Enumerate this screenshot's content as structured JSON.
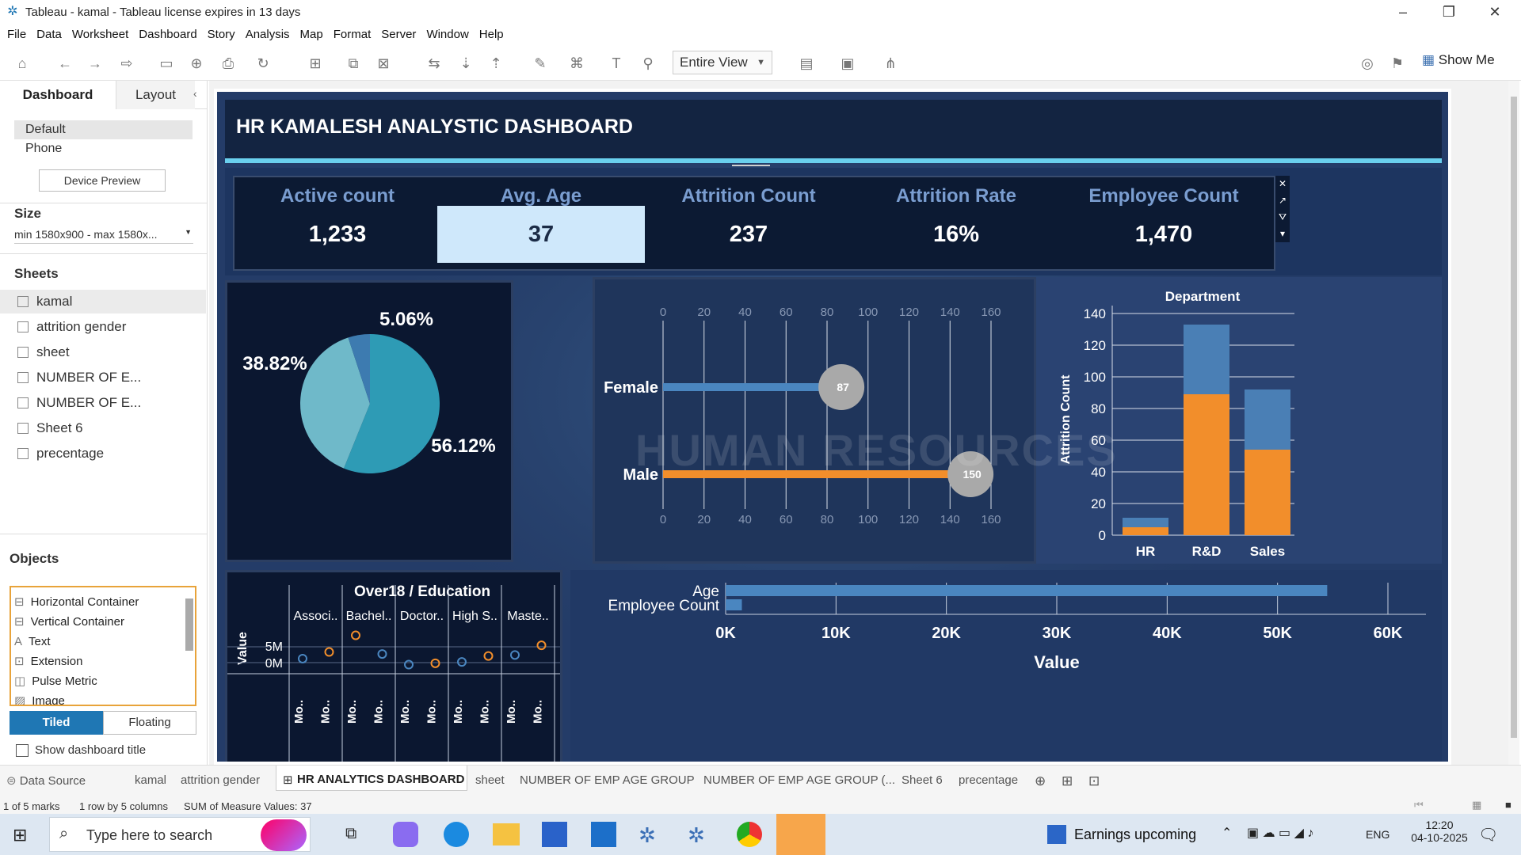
{
  "window": {
    "title": "Tableau - kamal - Tableau license expires in 13 days"
  },
  "menu": [
    "File",
    "Data",
    "Worksheet",
    "Dashboard",
    "Story",
    "Analysis",
    "Map",
    "Format",
    "Server",
    "Window",
    "Help"
  ],
  "toolbar": {
    "fit_label": "Entire View",
    "show_me": "Show Me"
  },
  "left_panel": {
    "tabs": [
      "Dashboard",
      "Layout"
    ],
    "devices": [
      "Default",
      "Phone"
    ],
    "device_preview": "Device Preview",
    "size_header": "Size",
    "size_value": "min 1580x900 - max 1580x...",
    "sheets_header": "Sheets",
    "sheets": [
      "kamal",
      "attrition gender",
      "sheet",
      "NUMBER OF E...",
      "NUMBER OF E...",
      "Sheet 6",
      "precentage"
    ],
    "objects_header": "Objects",
    "objects": [
      "Horizontal Container",
      "Vertical Container",
      "Text",
      "Extension",
      "Pulse Metric",
      "Image"
    ],
    "tiled": "Tiled",
    "floating": "Floating",
    "show_title": "Show dashboard title"
  },
  "dashboard": {
    "title": "HR KAMALESH ANALYSTIC DASHBOARD",
    "kpis": [
      {
        "label": "Active count",
        "value": "1,233"
      },
      {
        "label": "Avg. Age",
        "value": "37"
      },
      {
        "label": "Attrition Count",
        "value": "237"
      },
      {
        "label": "Attrition Rate",
        "value": "16%"
      },
      {
        "label": "Employee Count",
        "value": "1,470"
      }
    ],
    "watermark": "HUMAN RESOURCES"
  },
  "chart_data": [
    {
      "type": "pie",
      "slices": [
        {
          "label": "56.12%",
          "value": 56.12,
          "color": "#2e9bb5"
        },
        {
          "label": "38.82%",
          "value": 38.82,
          "color": "#6fb9c9"
        },
        {
          "label": "5.06%",
          "value": 5.06,
          "color": "#3d7bb0"
        }
      ]
    },
    {
      "type": "bar",
      "categories": [
        "Female",
        "Male"
      ],
      "values": [
        87,
        150
      ],
      "data_labels": [
        "87",
        "150"
      ],
      "colors": [
        "#4a86c0",
        "#f28e2b"
      ],
      "xticks": [
        "0",
        "20",
        "40",
        "60",
        "80",
        "100",
        "120",
        "140",
        "160"
      ],
      "xlim": [
        0,
        160
      ]
    },
    {
      "type": "bar",
      "title": "Department",
      "ylabel": "Attrition Count",
      "categories": [
        "HR",
        "R&D",
        "Sales"
      ],
      "series": [
        {
          "values": [
            5,
            89,
            54
          ],
          "color": "#f28e2b"
        },
        {
          "values": [
            6,
            44,
            38
          ],
          "color": "#4a7fb5"
        }
      ],
      "yticks": [
        "0",
        "20",
        "40",
        "60",
        "80",
        "100",
        "120",
        "140"
      ],
      "ylim": [
        0,
        145
      ]
    },
    {
      "type": "scatter",
      "title": "Over18 / Education",
      "ylabel": "Value",
      "columns": [
        "Associ..",
        "Bachel..",
        "Doctor..",
        "High S..",
        "Maste.."
      ],
      "xlabels": [
        "Mo..",
        "Mo..",
        "Mo..",
        "Mo..",
        "Mo..",
        "Mo..",
        "Mo..",
        "Mo..",
        "Mo..",
        "Mo.."
      ],
      "yticks": [
        "5M",
        "0M"
      ],
      "points": [
        {
          "col": 0,
          "x": 0,
          "y": 1.2,
          "color": "#4a86c0"
        },
        {
          "col": 0,
          "x": 1,
          "y": 3.2,
          "color": "#f28e2b"
        },
        {
          "col": 1,
          "x": 0,
          "y": 8.2,
          "color": "#f28e2b"
        },
        {
          "col": 1,
          "x": 1,
          "y": 2.6,
          "color": "#4a86c0"
        },
        {
          "col": 2,
          "x": 0,
          "y": -0.6,
          "color": "#4a86c0"
        },
        {
          "col": 2,
          "x": 1,
          "y": -0.2,
          "color": "#f28e2b"
        },
        {
          "col": 3,
          "x": 0,
          "y": 0.2,
          "color": "#4a86c0"
        },
        {
          "col": 3,
          "x": 1,
          "y": 2.0,
          "color": "#f28e2b"
        },
        {
          "col": 4,
          "x": 0,
          "y": 2.3,
          "color": "#4a86c0"
        },
        {
          "col": 4,
          "x": 1,
          "y": 5.2,
          "color": "#f28e2b"
        }
      ]
    },
    {
      "type": "bar",
      "categories": [
        "Age",
        "Employee Count"
      ],
      "values": [
        54500,
        1470
      ],
      "xlabel": "Value",
      "xticks": [
        "0K",
        "10K",
        "20K",
        "30K",
        "40K",
        "50K",
        "60K"
      ],
      "xlim": [
        0,
        60000
      ],
      "color": "#4a86c0"
    }
  ],
  "bottom_tabs": [
    "Data Source",
    "kamal",
    "attrition gender",
    "HR ANALYTICS DASHBOARD",
    "sheet",
    "NUMBER OF EMP AGE GROUP",
    "NUMBER OF EMP AGE GROUP (...",
    "Sheet 6",
    "precentage"
  ],
  "status": {
    "marks": "1 of 5 marks",
    "rows": "1 row by 5 columns",
    "sum": "SUM of Measure Values: 37"
  },
  "taskbar": {
    "search_placeholder": "Type here to search",
    "news": "Earnings upcoming",
    "lang": "ENG",
    "time": "12:20",
    "date": "04-10-2025"
  }
}
